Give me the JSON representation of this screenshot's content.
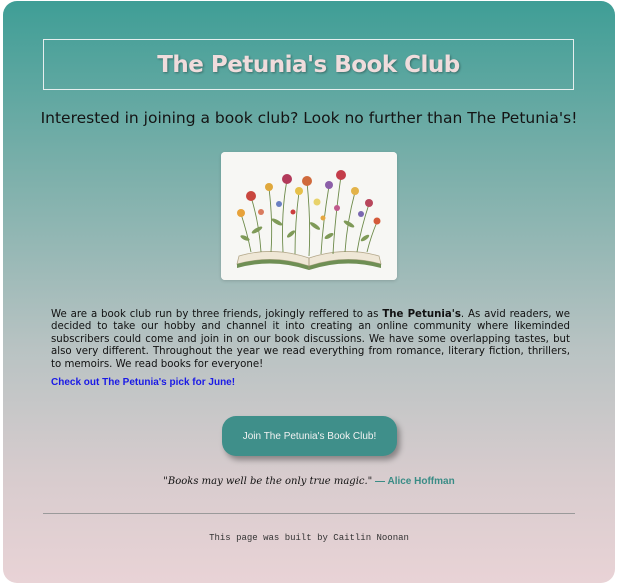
{
  "header": {
    "title": "The Petunia's Book Club"
  },
  "tagline": "Interested in joining a book club? Look no further than The Petunia's!",
  "hero_image": {
    "alt": "Open book with pressed flowers growing out of its pages",
    "icon": "book-flowers-image"
  },
  "about": {
    "part1": "We are a book club run by three friends, jokingly reffered to as ",
    "bold": "The Petunia's",
    "part2": ". As avid readers, we decided to take our hobby and channel it into creating an online community where likeminded subscribers could come and join in on our book discussions. We have some overlapping tastes, but also very different. Throughout the year we read everything from romance, literary fiction, thrillers, to memoirs. We read books for everyone!"
  },
  "june_link": "Check out The Petunia's pick for June!",
  "join_button": "Join The Petunia's Book Club!",
  "quote": {
    "text": "\"Books may well be the only true magic.\"",
    "dash": " — ",
    "author": "Alice Hoffman"
  },
  "footer": "This page was built by Caitlin Noonan",
  "colors": {
    "gradient_top": "#3f9e96",
    "gradient_bottom": "#e9d3d6",
    "button": "#3f8f8a",
    "link": "#1a1ae6",
    "author": "#3a8c86"
  }
}
